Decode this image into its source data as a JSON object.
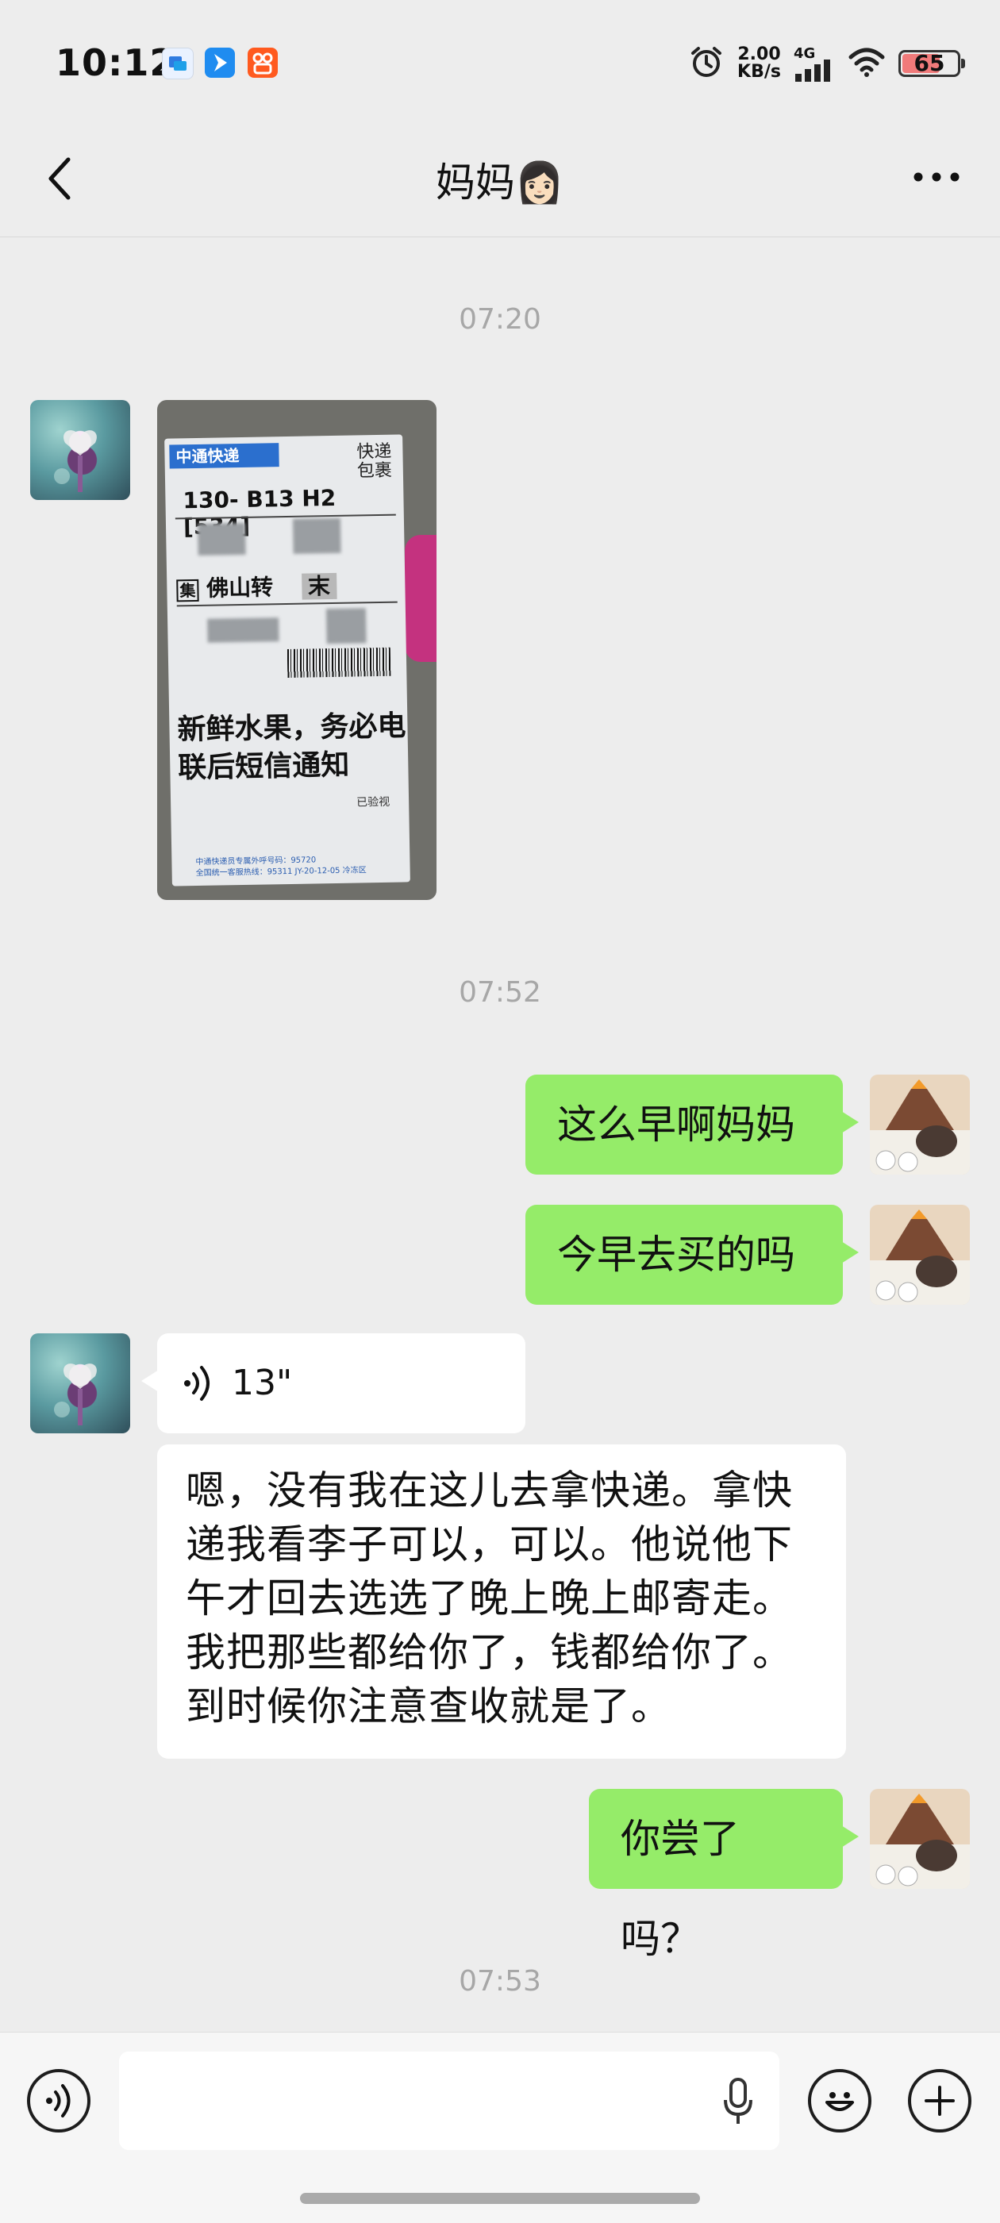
{
  "status_bar": {
    "time": "10:12",
    "net_speed_value": "2.00",
    "net_speed_unit": "KB/s",
    "signal_label": "4G",
    "battery_level": "65",
    "icons": [
      "app-badge-blue-icon",
      "app-badge-navigate-icon",
      "app-badge-kuaishou-icon",
      "alarm-icon",
      "signal-icon",
      "wifi-icon",
      "battery-icon"
    ]
  },
  "nav": {
    "title": "妈妈👩🏻",
    "back_icon": "chevron-left-icon",
    "more_icon": "more-dots-icon"
  },
  "messages": {
    "timestamp_1": "07:20",
    "image_label": {
      "brand": "中通快递",
      "type_top": "快递",
      "type_bottom": "包裹",
      "sort_code": "130- B13 H2 [534]",
      "route_prefix": "集",
      "route": "佛山转",
      "route_suffix": "末",
      "note": "新鲜水果，务必电联后短信通知",
      "small_tag": "已验视",
      "footer_line1": "中通快递员专属外呼号码：95720",
      "footer_line2": "全国统一客服热线：95311 JY-20-12-05 冷冻区"
    },
    "timestamp_2": "07:52",
    "sent_1": "这么早啊妈妈",
    "sent_2": "今早去买的吗",
    "voice_duration": "13\"",
    "transcript": "嗯，没有我在这儿去拿快递。拿快递我看李子可以，可以。他说他下午才回去选选了晚上晚上邮寄走。我把那些都给你了，钱都给你了。到时候你注意查收就是了。",
    "sent_3": "你尝了吗？",
    "timestamp_3": "07:53"
  },
  "input_bar": {
    "voice_icon": "voice-input-icon",
    "mic_icon": "microphone-icon",
    "emoji_icon": "emoji-icon",
    "add_icon": "plus-icon",
    "placeholder": ""
  },
  "colors": {
    "sent_bubble": "#95ec69",
    "received_bubble": "#ffffff",
    "background": "#ededed"
  }
}
